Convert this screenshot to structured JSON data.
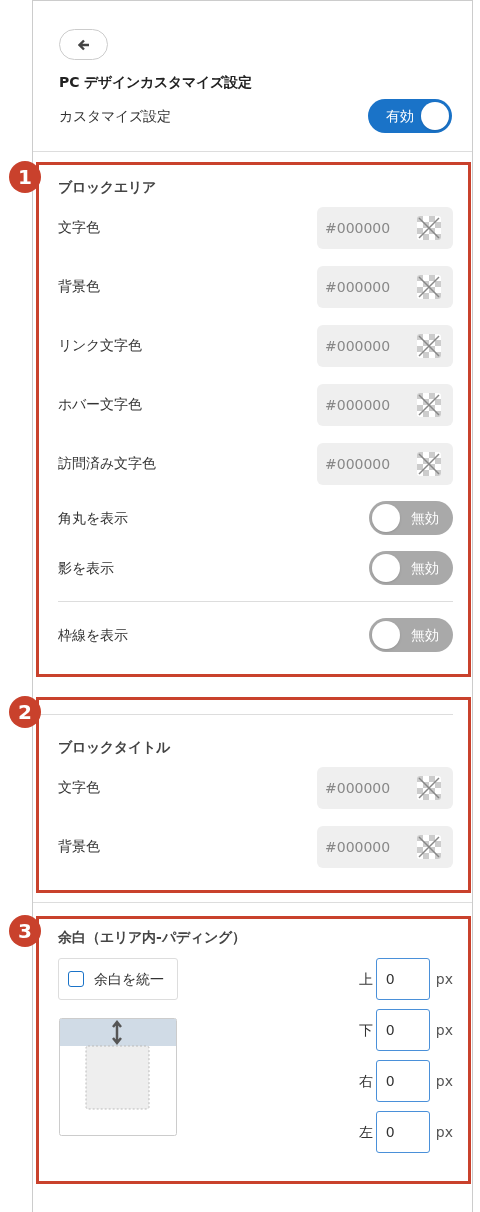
{
  "header": {
    "title": "PC デザインカスタマイズ設定",
    "toggle": {
      "label": "カスタマイズ設定",
      "on": true,
      "state_text": "有効"
    }
  },
  "block_area": {
    "badge": "1",
    "title": "ブロックエリア",
    "rows": [
      {
        "kind": "color",
        "label": "文字色",
        "placeholder": "#000000"
      },
      {
        "kind": "color",
        "label": "背景色",
        "placeholder": "#000000"
      },
      {
        "kind": "color",
        "label": "リンク文字色",
        "placeholder": "#000000"
      },
      {
        "kind": "color",
        "label": "ホバー文字色",
        "placeholder": "#000000"
      },
      {
        "kind": "color",
        "label": "訪問済み文字色",
        "placeholder": "#000000"
      },
      {
        "kind": "toggle",
        "label": "角丸を表示",
        "on": false,
        "state_text": "無効"
      },
      {
        "kind": "toggle",
        "label": "影を表示",
        "on": false,
        "state_text": "無効"
      },
      {
        "kind": "toggle",
        "label": "枠線を表示",
        "on": false,
        "state_text": "無効",
        "divided": true
      }
    ]
  },
  "block_title": {
    "badge": "2",
    "title": "ブロックタイトル",
    "rows": [
      {
        "kind": "color",
        "label": "文字色",
        "placeholder": "#000000"
      },
      {
        "kind": "color",
        "label": "背景色",
        "placeholder": "#000000"
      }
    ]
  },
  "padding": {
    "badge": "3",
    "title": "余白（エリア内-パディング）",
    "unify": {
      "label": "余白を統一",
      "checked": false
    },
    "sides": [
      {
        "label": "上",
        "value": "0",
        "unit": "px"
      },
      {
        "label": "下",
        "value": "0",
        "unit": "px"
      },
      {
        "label": "右",
        "value": "0",
        "unit": "px"
      },
      {
        "label": "左",
        "value": "0",
        "unit": "px"
      }
    ]
  }
}
